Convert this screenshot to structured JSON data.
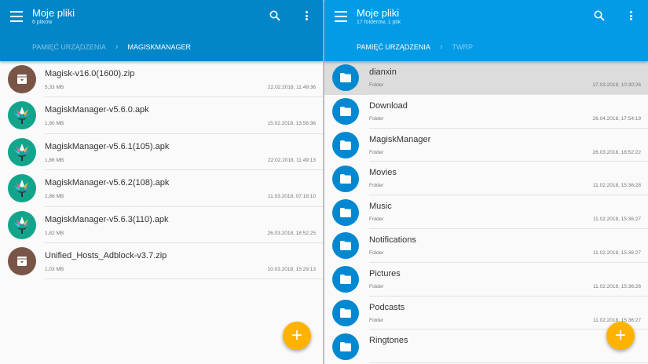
{
  "colors": {
    "left_bar": "#0386c8",
    "right_bar": "#039be5",
    "archive": "#795548",
    "folder": "#0288d1",
    "magisk": "#12a58c",
    "fab": "#ffb300"
  },
  "left": {
    "title": "Moje pliki",
    "subtitle": "6 plików",
    "crumbs": [
      "PAMIĘĆ URZĄDZENIA",
      "MAGISKMANAGER"
    ],
    "items": [
      {
        "name": "Magisk-v16.0(1600).zip",
        "meta": "5,33 MB",
        "date": "22.02.2018, 11:49:36",
        "icon": "archive"
      },
      {
        "name": "MagiskManager-v5.6.0.apk",
        "meta": "1,90 MB",
        "date": "15.02.2018, 13:56:36",
        "icon": "magisk"
      },
      {
        "name": "MagiskManager-v5.6.1(105).apk",
        "meta": "1,86 MB",
        "date": "22.02.2018, 11:49:13",
        "icon": "magisk"
      },
      {
        "name": "MagiskManager-v5.6.2(108).apk",
        "meta": "1,86 MB",
        "date": "11.03.2018, 07:18:10",
        "icon": "magisk"
      },
      {
        "name": "MagiskManager-v5.6.3(110).apk",
        "meta": "1,82 MB",
        "date": "26.03.2018, 18:52:25",
        "icon": "magisk"
      },
      {
        "name": "Unified_Hosts_Adblock-v3.7.zip",
        "meta": "1,03 MB",
        "date": "10.03.2018, 15:29:13",
        "icon": "archive"
      }
    ]
  },
  "right": {
    "title": "Moje pliki",
    "subtitle": "17 folderów, 1 plik",
    "crumbs": [
      "PAMIĘĆ URZĄDZENIA",
      "TWRP"
    ],
    "items": [
      {
        "name": "dianxin",
        "meta": "Folder",
        "date": "27.03.2018, 10:30:26"
      },
      {
        "name": "Download",
        "meta": "Folder",
        "date": "26.04.2018, 17:54:19"
      },
      {
        "name": "MagiskManager",
        "meta": "Folder",
        "date": "26.03.2018, 18:52:22"
      },
      {
        "name": "Movies",
        "meta": "Folder",
        "date": "11.02.2018, 15:36:28"
      },
      {
        "name": "Music",
        "meta": "Folder",
        "date": "11.02.2018, 15:36:27"
      },
      {
        "name": "Notifications",
        "meta": "Folder",
        "date": "11.02.2018, 15:36:27"
      },
      {
        "name": "Pictures",
        "meta": "Folder",
        "date": "11.02.2018, 15:36:28"
      },
      {
        "name": "Podcasts",
        "meta": "Folder",
        "date": "11.02.2018, 15:36:27"
      },
      {
        "name": "Ringtones",
        "meta": "",
        "date": ""
      }
    ]
  },
  "fab_label": "+"
}
